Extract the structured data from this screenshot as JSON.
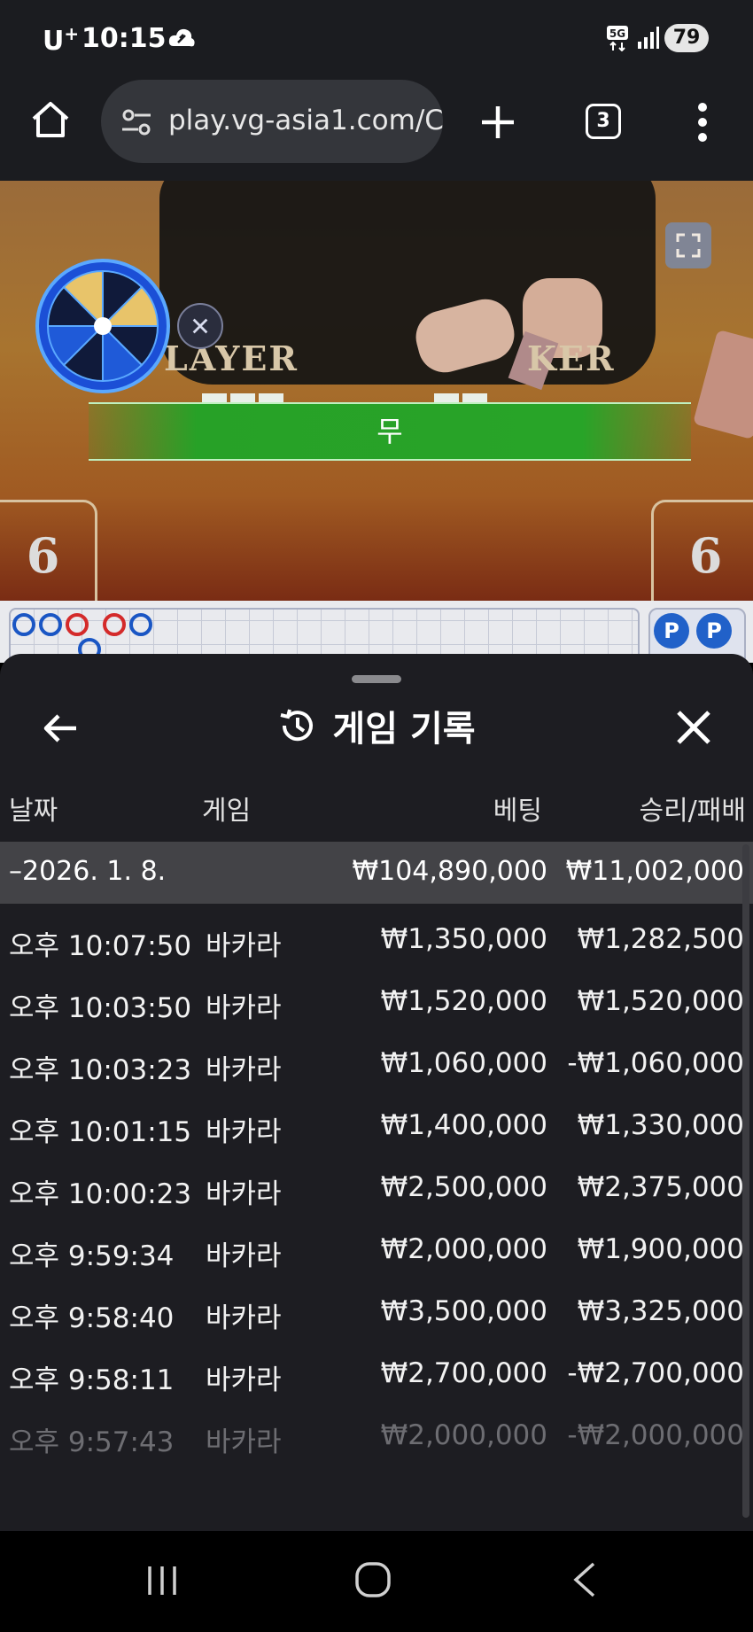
{
  "status_bar": {
    "carrier": "U",
    "carrier_sup": "+",
    "time": "10:15",
    "network": "5G",
    "battery": "79"
  },
  "browser": {
    "url": "play.vg-asia1.com/C",
    "tab_count": "3"
  },
  "video": {
    "player_label": "LAYER",
    "banker_label": "KER",
    "result": "무",
    "player_score": "6",
    "banker_score": "6"
  },
  "roadmap": {
    "badges": [
      "P",
      "P"
    ]
  },
  "sheet": {
    "title": "게임 기록",
    "columns": {
      "date": "날짜",
      "game": "게임",
      "bet": "베팅",
      "win_loss": "승리/패배"
    },
    "summary": {
      "date": "–2026. 1. 8.",
      "bet": "₩104,890,000",
      "win_loss": "₩11,002,000"
    },
    "rows": [
      {
        "time": "오후 10:07:50",
        "game": "바카라",
        "bet": "₩1,350,000",
        "win_loss": "₩1,282,500"
      },
      {
        "time": "오후 10:03:50",
        "game": "바카라",
        "bet": "₩1,520,000",
        "win_loss": "₩1,520,000"
      },
      {
        "time": "오후 10:03:23",
        "game": "바카라",
        "bet": "₩1,060,000",
        "win_loss": "-₩1,060,000"
      },
      {
        "time": "오후 10:01:15",
        "game": "바카라",
        "bet": "₩1,400,000",
        "win_loss": "₩1,330,000"
      },
      {
        "time": "오후 10:00:23",
        "game": "바카라",
        "bet": "₩2,500,000",
        "win_loss": "₩2,375,000"
      },
      {
        "time": "오후 9:59:34",
        "game": "바카라",
        "bet": "₩2,000,000",
        "win_loss": "₩1,900,000"
      },
      {
        "time": "오후 9:58:40",
        "game": "바카라",
        "bet": "₩3,500,000",
        "win_loss": "₩3,325,000"
      },
      {
        "time": "오후 9:58:11",
        "game": "바카라",
        "bet": "₩2,700,000",
        "win_loss": "-₩2,700,000"
      },
      {
        "time": "오후 9:57:43",
        "game": "바카라",
        "bet": "₩2,000,000",
        "win_loss": "-₩2,000,000"
      }
    ]
  },
  "colors": {
    "sheet_bg": "#1d1d22",
    "summary_bg": "#434347",
    "result_banner": "#28a428",
    "roadmap_blue": "#1a56c4",
    "roadmap_red": "#d42a2a"
  }
}
